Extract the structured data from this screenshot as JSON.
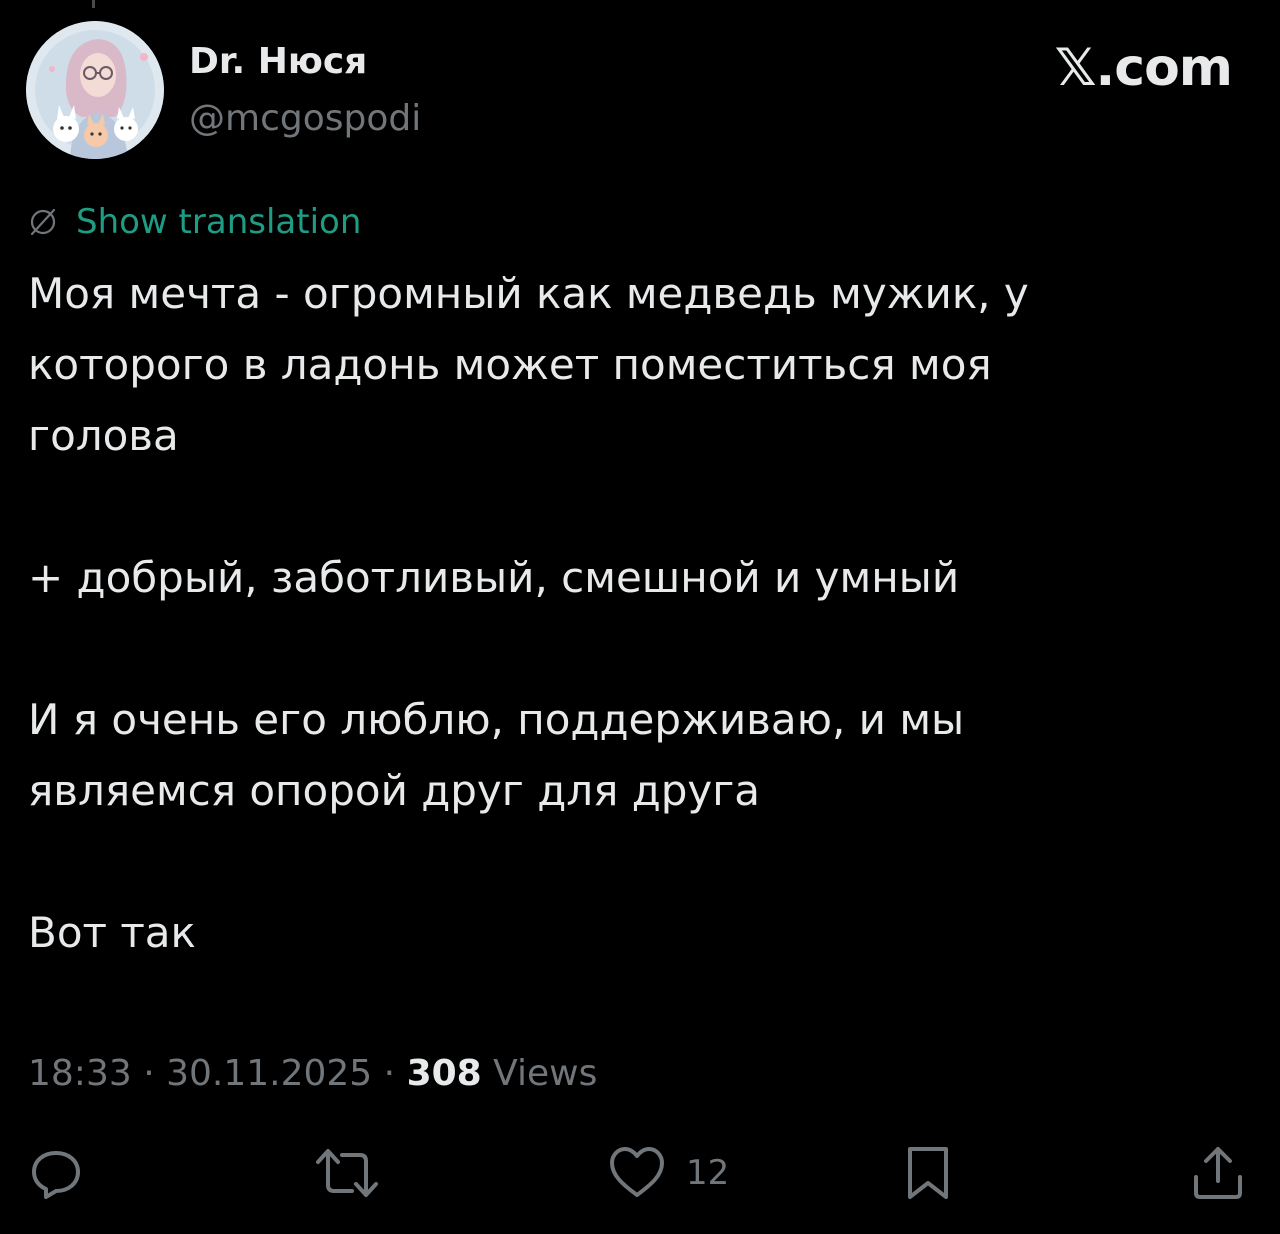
{
  "author": {
    "display_name": "Dr. Нюся",
    "handle": "@mcgospodi",
    "avatar_icon": "avatar-illustration"
  },
  "brand": {
    "label": "𝕏.com"
  },
  "translation": {
    "icon": "globe-icon",
    "label": "Show translation",
    "color": "#1f9c84"
  },
  "tweet": {
    "line_1": "Моя мечта - огромный как медведь мужик, у",
    "line_2": "которого в ладонь может поместиться моя",
    "line_3": "голова",
    "line_4": "+ добрый, заботливый, смешной и умный",
    "line_5": "И я очень его люблю, поддерживаю, и мы",
    "line_6": "являемся опорой друг для друга",
    "line_7": "Вот так"
  },
  "meta": {
    "time": "18:33",
    "separator": " · ",
    "date": "30.11.2025",
    "views_count": "308",
    "views_label": "Views"
  },
  "actions": {
    "reply_icon": "reply-icon",
    "repost_icon": "repost-icon",
    "like_icon": "heart-icon",
    "like_count": "12",
    "bookmark_icon": "bookmark-icon",
    "share_icon": "share-icon"
  },
  "colors": {
    "background": "#000000",
    "primary_text": "#e7e9ea",
    "secondary_text": "#71767b"
  }
}
